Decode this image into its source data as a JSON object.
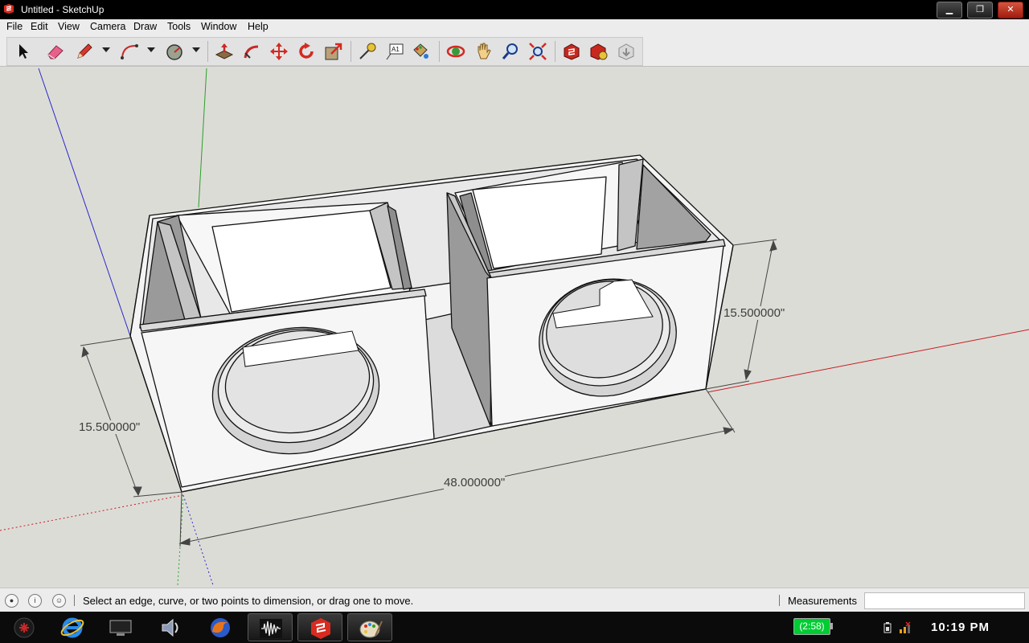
{
  "window": {
    "title": "Untitled - SketchUp",
    "minimize_glyph": "▁",
    "restore_glyph": "❐",
    "close_glyph": "✕"
  },
  "menu": {
    "items": [
      "File",
      "Edit",
      "View",
      "Camera",
      "Draw",
      "Tools",
      "Window",
      "Help"
    ]
  },
  "toolbar": {
    "tools": [
      "select-tool",
      "eraser-tool",
      "pencil-tool",
      "arc-tool",
      "circle-tool",
      "push-pull-tool",
      "follow-me-tool",
      "move-tool",
      "rotate-tool",
      "scale-tool",
      "tape-measure-tool",
      "text-tool",
      "paint-bucket-tool",
      "orbit-tool",
      "pan-tool",
      "zoom-tool",
      "zoom-extents-tool",
      "3d-warehouse-tool",
      "share-model-tool",
      "get-models-tool"
    ],
    "text_tool_glyph": "A1"
  },
  "model": {
    "dimensions": {
      "left_height": "15.500000\"",
      "right_height": "15.500000\"",
      "length": "48.000000\""
    },
    "colors": {
      "viewport_bg": "#dcdcd7",
      "axis_red": "#c81e1e",
      "axis_green": "#1ea01e",
      "axis_blue": "#2020c8"
    }
  },
  "status": {
    "hint": "Select an edge, curve, or two points to dimension, or drag one to move.",
    "measurements_label": "Measurements",
    "measurements_value": "",
    "info_glyph": "i"
  },
  "taskbar": {
    "apps": [
      "start-orb",
      "internet-explorer",
      "show-desktop",
      "media-player",
      "firefox",
      "audio-editor",
      "sketchup",
      "paint"
    ],
    "battery_text": "(2:58)",
    "clock": "10:19 PM"
  }
}
